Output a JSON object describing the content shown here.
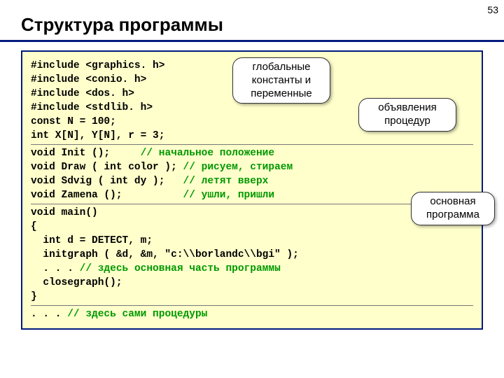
{
  "page_number": "53",
  "title": "Структура программы",
  "callouts": {
    "globals": "глобальные константы и переменные",
    "decls": "объявления процедур",
    "main": "основная программа"
  },
  "code": {
    "l01a": "#include <graphics. h>",
    "l01b": "#include <conio. h>",
    "l01c": "#include <dos. h>",
    "l01d": "#include <stdlib. h>",
    "l02": "const N = 100;",
    "l03": "int X[N], Y[N], r = 3;",
    "l04a": "void Init ();     ",
    "l04a_c": "// начальное положение",
    "l04b": "void Draw ( int color ); ",
    "l04b_c": "// рисуем, стираем",
    "l04c": "void Sdvig ( int dy );   ",
    "l04c_c": "// летят вверх",
    "l04d": "void Zamena ();          ",
    "l04d_c": "// ушли, пришли",
    "l05": "void main()",
    "l06": "{",
    "l07": "  int d = DETECT, m;",
    "l08": "  initgraph ( &d, &m, \"c:\\\\borlandc\\\\bgi\" );",
    "l09a": "  . . . ",
    "l09a_c": "// здесь основная часть программы",
    "l10": "  closegraph();",
    "l11": "}",
    "l12a": ". . . ",
    "l12a_c": "// здесь сами процедуры"
  }
}
